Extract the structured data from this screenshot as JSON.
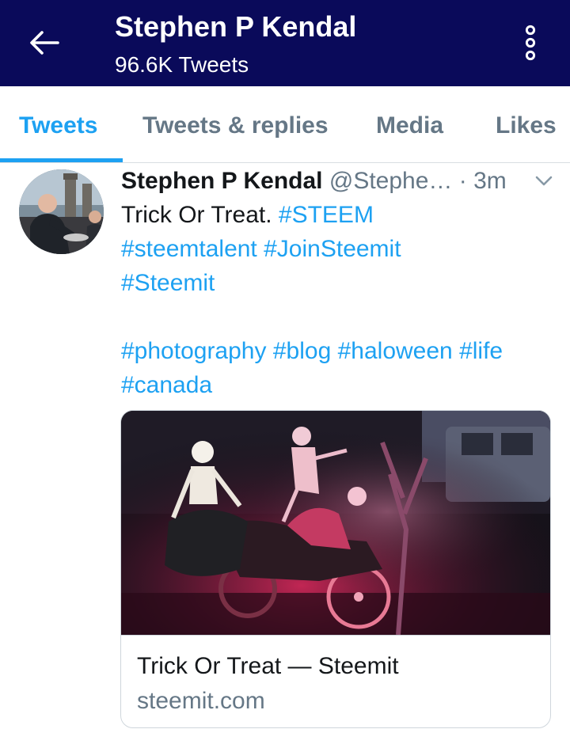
{
  "colors": {
    "topbar": "#0a0a5a",
    "accent": "#1da1f2",
    "muted": "#657786",
    "text": "#14171a"
  },
  "header": {
    "back_icon": "arrow-left-icon",
    "title": "Stephen P Kendal",
    "subtitle": "96.6K Tweets",
    "more_icon": "more-vertical-icon"
  },
  "tabs": [
    {
      "label": "Tweets",
      "active": true
    },
    {
      "label": "Tweets & replies",
      "active": false
    },
    {
      "label": "Media",
      "active": false
    },
    {
      "label": "Likes",
      "active": false
    }
  ],
  "tweet": {
    "author_name": "Stephen P Kendal",
    "author_handle": "@Stephe…",
    "separator": "·",
    "time": "3m",
    "caret_icon": "chevron-down-icon",
    "text": {
      "line1_prefix": "Trick Or Treat. ",
      "hashtags": [
        "#STEEM",
        "#steemtalent",
        "#JoinSteemit",
        "#Steemit",
        "#photography",
        "#blog",
        "#haloween",
        "#life",
        "#canada"
      ]
    },
    "card": {
      "image_icon": "halloween-skeleton-motorcycle-photo",
      "title": "Trick Or Treat — Steemit",
      "domain": "steemit.com"
    }
  }
}
